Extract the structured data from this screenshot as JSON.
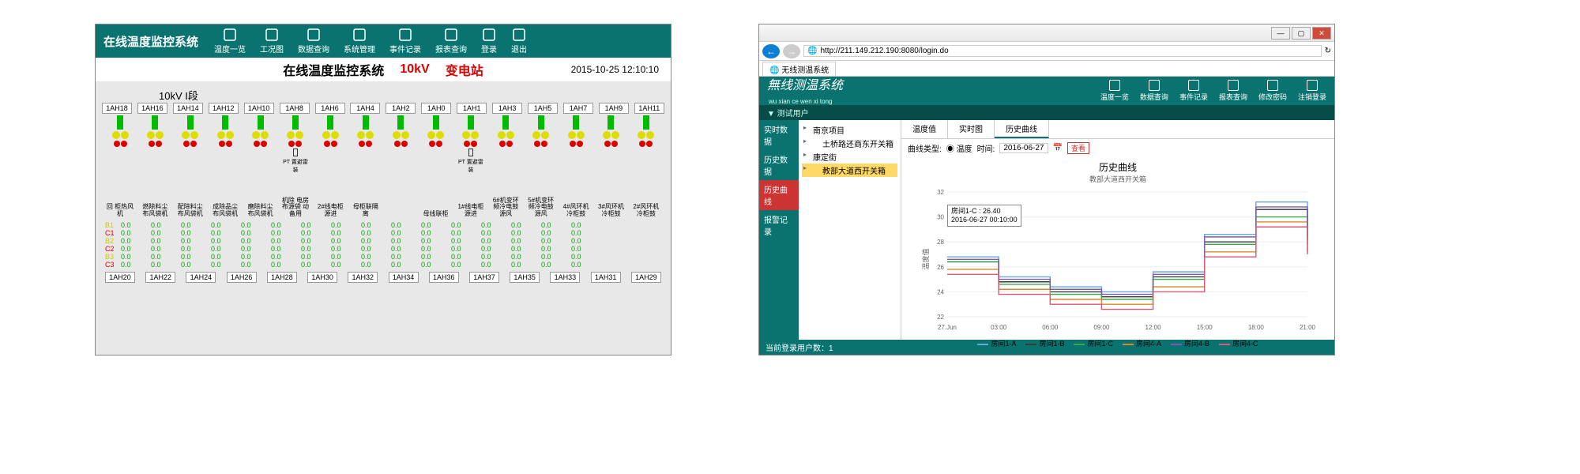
{
  "left": {
    "title": "在线温度监控系统",
    "menu": [
      "温度一览",
      "工况图",
      "数据查询",
      "系统管理",
      "事件记录",
      "报表查询",
      "登录",
      "退出"
    ],
    "sub_title": "在线温度监控系统",
    "sub_voltage": "10kV",
    "sub_station": "变电站",
    "timestamp": "2015-10-25 12:10:10",
    "bus_label": "10kV I段",
    "top_bays": [
      "1AH18",
      "1AH16",
      "1AH14",
      "1AH12",
      "1AH10",
      "1AH8",
      "1AH6",
      "1AH4",
      "1AH2",
      "1AH0",
      "1AH1",
      "1AH3",
      "1AH5",
      "1AH7",
      "1AH9",
      "1AH11"
    ],
    "bottom_bays": [
      "1AH20",
      "1AH22",
      "1AH24",
      "1AH26",
      "1AH28",
      "1AH30",
      "1AH32",
      "1AH34",
      "1AH36",
      "1AH37",
      "1AH35",
      "1AH33",
      "1AH31",
      "1AH29"
    ],
    "bay_names": [
      "回 柜热风机",
      "燃除料尘布风袋机",
      "配除料尘布风袋机",
      "成除品尘布风袋机",
      "磨除料尘布风袋机",
      "机除 电房布源袋 动备用",
      "2#线电柜源进",
      "母柜联隔离",
      "",
      "母线联柜",
      " 1#线电柜源进",
      "6#机变环频冷电鼓源风",
      "5#机变环频冷电鼓源风",
      "4#风环机冷柜鼓",
      "3#风环机冷柜鼓",
      "2#风环机冷柜鼓"
    ],
    "pt_label": "PT 置避雷装",
    "row_labels": [
      "B1",
      "C1",
      "B2",
      "C2",
      "B3",
      "C3"
    ],
    "zero": "0.0"
  },
  "right": {
    "url": "http://211.149.212.190:8080/login.do",
    "tab": "无线测温系统",
    "brand": "無线测温系统",
    "brand_pinyin": "wu xian ce wen xi tong",
    "user_label": "▼ 测试用户",
    "app_menu": [
      "温度一览",
      "数据查询",
      "事件记录",
      "报表查询",
      "修改密码",
      "注销登录"
    ],
    "side": [
      "实时数据",
      "历史数据",
      "历史曲线",
      "报警记录"
    ],
    "tree": {
      "root1": "南京项目",
      "child1": "土桥路还商东开关箱",
      "root2": "康定街",
      "child2_sel": "教部大道西开关箱"
    },
    "tabs2": [
      "温度值",
      "实时图",
      "历史曲线"
    ],
    "filter": {
      "label": "曲线类型:",
      "radio": "温度",
      "time_label": "时间:",
      "date": "2016-06-27",
      "btn": "查看"
    },
    "chart": {
      "title": "历史曲线",
      "subtitle": "教部大道西开关箱",
      "tooltip_name": "房间1-C : 26.40",
      "tooltip_time": "2016-06-27 00:10:00",
      "ylabel": "温度值"
    },
    "status": "当前登录用户数：1"
  },
  "chart_data": {
    "type": "line",
    "title": "历史曲线",
    "xlabel": "",
    "ylabel": "温度值",
    "ylim": [
      22,
      32
    ],
    "categories": [
      "27.Jun",
      "03:00",
      "06:00",
      "09:00",
      "12:00",
      "15:00",
      "18:00",
      "21:00"
    ],
    "series": [
      {
        "name": "房间1-A",
        "color": "#6aa8d8",
        "values": [
          26.8,
          25.2,
          24.4,
          24.0,
          25.6,
          28.6,
          31.2,
          28.8
        ]
      },
      {
        "name": "房间1-B",
        "color": "#3a3a3a",
        "values": [
          26.4,
          24.8,
          24.0,
          23.6,
          25.2,
          28.0,
          30.6,
          28.2
        ]
      },
      {
        "name": "房间1-C",
        "color": "#3aa84a",
        "values": [
          26.4,
          24.6,
          23.8,
          23.4,
          25.0,
          27.8,
          30.0,
          27.8
        ]
      },
      {
        "name": "房间4-A",
        "color": "#d88a2a",
        "values": [
          25.8,
          24.2,
          23.4,
          23.0,
          24.4,
          27.2,
          29.6,
          27.2
        ]
      },
      {
        "name": "房间4-B",
        "color": "#7a5ab8",
        "values": [
          26.6,
          25.0,
          24.2,
          23.8,
          25.4,
          28.4,
          30.8,
          28.4
        ]
      },
      {
        "name": "房间4-C",
        "color": "#d85a7a",
        "values": [
          25.4,
          23.8,
          23.0,
          22.6,
          24.0,
          26.8,
          29.2,
          27.0
        ]
      }
    ],
    "legend_position": "bottom"
  }
}
